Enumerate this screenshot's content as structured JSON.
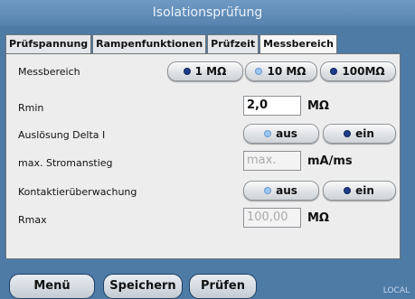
{
  "window": {
    "title": "Isolationsprüfung"
  },
  "tabs": [
    {
      "label": "Prüfspannung",
      "active": false
    },
    {
      "label": "Rampenfunktionen",
      "active": false
    },
    {
      "label": "Prüfzeit",
      "active": false
    },
    {
      "label": "Messbereich",
      "active": true
    }
  ],
  "settings": {
    "messbereich": {
      "label": "Messbereich",
      "options": [
        "1 MΩ",
        "10 MΩ",
        "100MΩ"
      ],
      "selected": "1 MΩ"
    },
    "rmin": {
      "label": "Rmin",
      "value": "2,0",
      "unit": "MΩ"
    },
    "ausloesung": {
      "label": "Auslösung Delta I",
      "off_label": "aus",
      "on_label": "ein",
      "selected": "ein"
    },
    "stromanstieg": {
      "label": "max. Stromanstieg",
      "placeholder": "max.",
      "unit": "mA/ms"
    },
    "kontaktierung": {
      "label": "Kontaktierüberwachung",
      "off_label": "aus",
      "on_label": "ein",
      "selected": "ein"
    },
    "rmax": {
      "label": "Rmax",
      "value": "100,00",
      "unit": "MΩ"
    }
  },
  "footer": {
    "menu_label": "Menü",
    "save_label": "Speichern",
    "test_label": "Prüfen",
    "mode_text": "LOCAL"
  },
  "colors": {
    "background": "#4d7ba6",
    "panel": "#ededed",
    "radio_selected": "#1f3c8c",
    "radio_unselected": "#9ec6f2"
  }
}
